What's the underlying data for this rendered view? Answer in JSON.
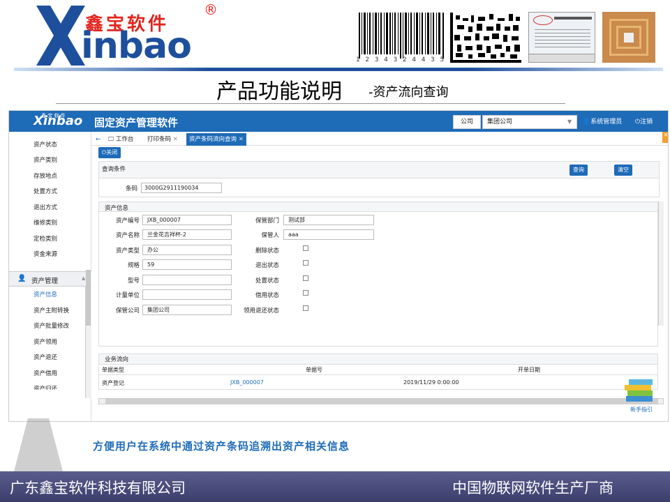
{
  "banner": {
    "logo_cn": "鑫宝软件",
    "logo_reg": "®",
    "logo_en": "inbao",
    "barcode_number": "1 2 3 4 3 2 4 4 3 5 1 1 1",
    "heading": "产品功能说明",
    "subheading": "-资产流向查询"
  },
  "app": {
    "logo": "Xinbao",
    "logo_small": "鑫 宝 软 件",
    "title": "固定资产管理软件",
    "company_label": "公司",
    "company_value": "集团公司",
    "user": "系统管理员",
    "logout": "注销"
  },
  "sidebar": {
    "items": [
      "资产状态",
      "资产类别",
      "存放地点",
      "处置方式",
      "退出方式",
      "维修类别",
      "定检类别",
      "资金来源"
    ],
    "section": "资产管理",
    "sub_items": [
      "资产信息",
      "资产主附转换",
      "资产批量修改",
      "资产领用",
      "资产退还",
      "资产借用",
      "资产归还"
    ]
  },
  "tabs": {
    "home": "工作台",
    "print": "打印条码",
    "active": "资产条码流向查询"
  },
  "close_button": "关闭",
  "query": {
    "title": "查询条件",
    "search_button": "查询",
    "clear_button": "清空",
    "barcode_label": "条码",
    "barcode_value": "3000G2911190034"
  },
  "info": {
    "title": "资产信息",
    "fields_left": [
      {
        "label": "资产编号",
        "value": "JXB_000007"
      },
      {
        "label": "资产名称",
        "value": "兰金花吉祥杯-2"
      },
      {
        "label": "资产类型",
        "value": "办公"
      },
      {
        "label": "规格",
        "value": "59"
      },
      {
        "label": "型号",
        "value": ""
      },
      {
        "label": "计量单位",
        "value": ""
      },
      {
        "label": "保管公司",
        "value": "集团公司"
      }
    ],
    "fields_right": [
      {
        "label": "保管部门",
        "value": "测试部"
      },
      {
        "label": "保管人",
        "value": "aaa"
      },
      {
        "label": "删除状态"
      },
      {
        "label": "退出状态"
      },
      {
        "label": "处置状态"
      },
      {
        "label": "借用状态"
      },
      {
        "label": "领用退还状态"
      }
    ]
  },
  "flow": {
    "title": "业务流向",
    "columns": [
      "单据类型",
      "单据号",
      "开单日期"
    ],
    "row": [
      "资产登记",
      "JXB_000007",
      "2019/11/29 0:00:00"
    ]
  },
  "newbie": "新手指引",
  "tagline": "方便用户在系统中通过资产条码追溯出资产相关信息",
  "footer": {
    "left": "广东鑫宝软件科技有限公司",
    "right": "中国物联网软件生产厂商"
  },
  "colors": {
    "brand_blue": "#1e6bb8",
    "logo_red": "#e2251f",
    "footer": "#4a4c7c"
  }
}
